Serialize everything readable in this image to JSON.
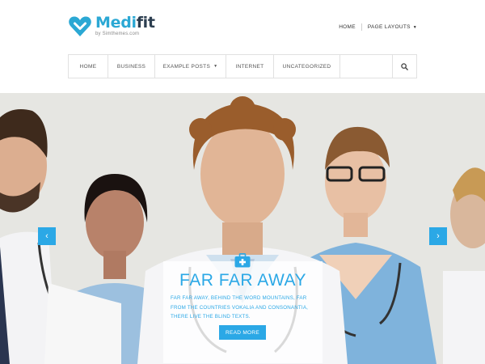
{
  "logo": {
    "name_part1": "Medi",
    "name_part2": "fit",
    "tagline": "by Simthemes.com",
    "icon": "heart-logo-icon"
  },
  "topnav": {
    "items": [
      "HOME",
      "PAGE LAYOUTS"
    ],
    "caret_icon": "caret-down-icon"
  },
  "mainnav": {
    "items": [
      "HOME",
      "BUSINESS",
      "EXAMPLE POSTS",
      "INTERNET",
      "UNCATEGORIZED"
    ],
    "search_icon": "search-icon"
  },
  "slider": {
    "prev_icon": "chevron-left-icon",
    "next_icon": "chevron-right-icon",
    "caption": {
      "icon": "medical-kit-icon",
      "title": "FAR FAR AWAY",
      "text": "FAR FAR AWAY, BEHIND THE WORD MOUNTAINS, FAR FROM THE COUNTRIES VOKALIA AND CONSONANTIA, THERE LIVE THE BLIND TEXTS.",
      "button": "READ MORE"
    }
  },
  "colors": {
    "accent": "#2ba8e6",
    "dark": "#2c3e50",
    "border": "#e1e1e1"
  }
}
